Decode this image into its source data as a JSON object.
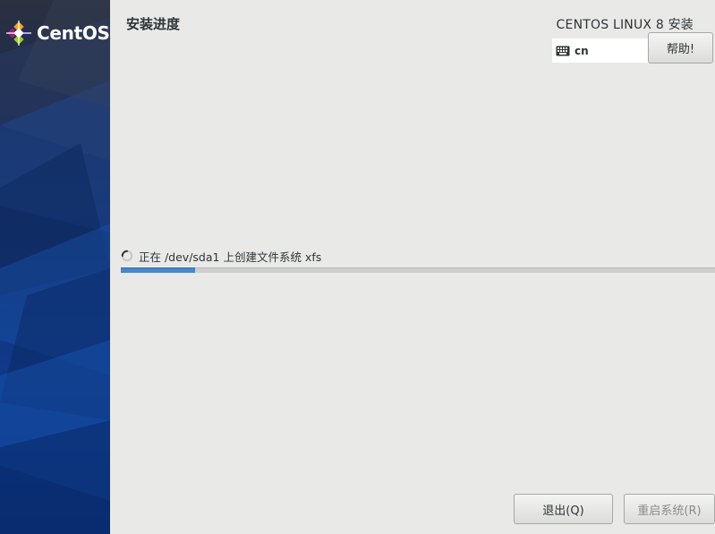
{
  "sidebar": {
    "brand": "CentOS"
  },
  "header": {
    "page_title": "安装进度",
    "product_title": "CENTOS LINUX 8 安装",
    "keyboard_layout": "cn",
    "help_label": "帮助!"
  },
  "progress": {
    "status_text": "正在 /dev/sda1 上创建文件系统 xfs",
    "fraction": 0.125
  },
  "footer": {
    "quit_label": "退出(Q)",
    "reboot_label": "重启系统(R)",
    "reboot_enabled": false
  },
  "colors": {
    "sidebar": "#12306e",
    "progress_fill": "#4a87c9",
    "background": "#e9e9e8"
  }
}
